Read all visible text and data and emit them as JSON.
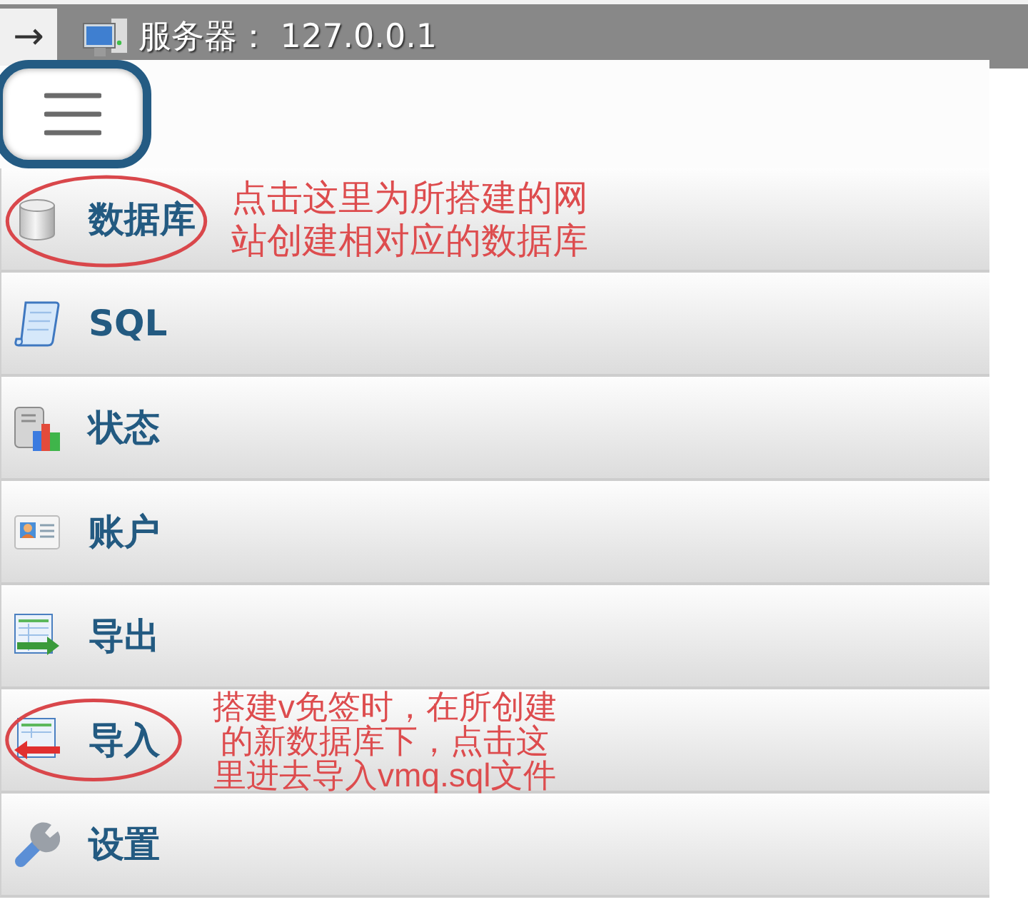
{
  "title_bar": {
    "button": "→",
    "title": "服务器： 127.0.0.1"
  },
  "menu": {
    "items": [
      {
        "label": "数据库",
        "annotation": "点击这里为所搭建的网站创建相对应的数据库"
      },
      {
        "label": "SQL"
      },
      {
        "label": "状态"
      },
      {
        "label": "账户"
      },
      {
        "label": "导出"
      },
      {
        "label": "导入",
        "annotation": "搭建v免签时，在所创建的新数据库下，点击这里进去导入vmq.sql文件"
      },
      {
        "label": "设置"
      }
    ]
  }
}
